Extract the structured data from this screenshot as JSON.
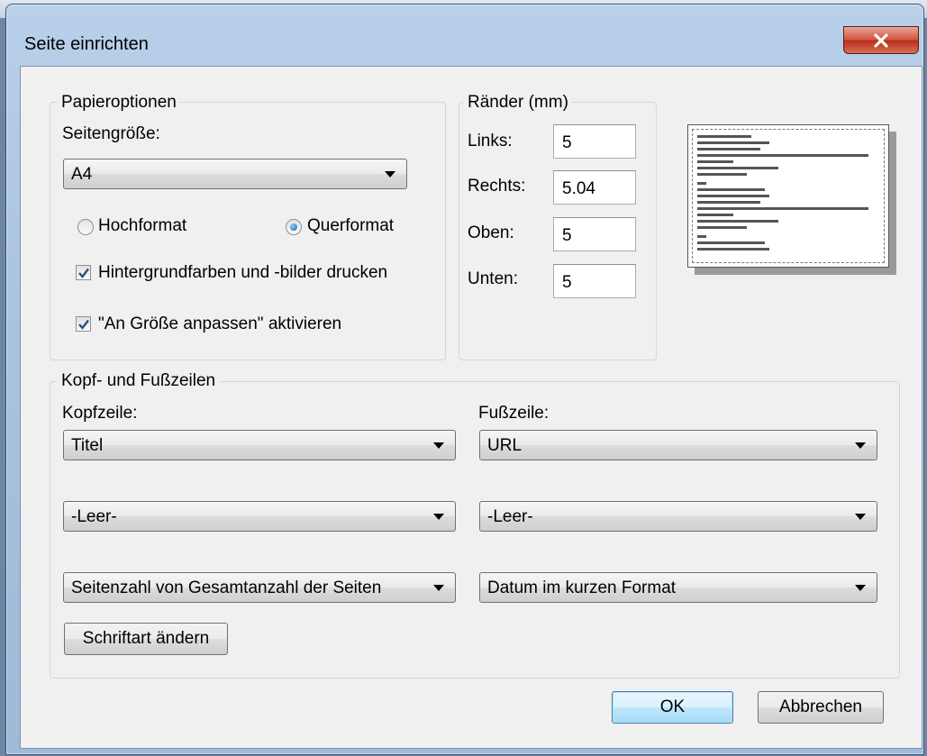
{
  "dialog": {
    "title": "Seite einrichten",
    "close_icon": "close-icon"
  },
  "paper": {
    "legend": "Papieroptionen",
    "size_label": "Seitengröße:",
    "size_value": "A4",
    "portrait_label": "Hochformat",
    "landscape_label": "Querformat",
    "orientation_selected": "Querformat",
    "print_background_label": "Hintergrundfarben und -bilder drucken",
    "print_background_checked": true,
    "shrink_to_fit_label": "\"An Größe anpassen\" aktivieren",
    "shrink_to_fit_checked": true
  },
  "margins": {
    "legend": "Ränder (mm)",
    "left_label": "Links:",
    "left_value": "5",
    "right_label": "Rechts:",
    "right_value": "5.04",
    "top_label": "Oben:",
    "top_value": "5",
    "bottom_label": "Unten:",
    "bottom_value": "5"
  },
  "headers_footers": {
    "legend": "Kopf- und Fußzeilen",
    "header_label": "Kopfzeile:",
    "footer_label": "Fußzeile:",
    "header_values": [
      "Titel",
      "-Leer-",
      "Seitenzahl von Gesamtanzahl der Seiten"
    ],
    "footer_values": [
      "URL",
      "-Leer-",
      "Datum im kurzen Format"
    ],
    "change_font_label": "Schriftart ändern"
  },
  "buttons": {
    "ok_label": "OK",
    "cancel_label": "Abbrechen"
  },
  "colors": {
    "accent": "#3c7fb1",
    "close_button": "#c7432c"
  }
}
